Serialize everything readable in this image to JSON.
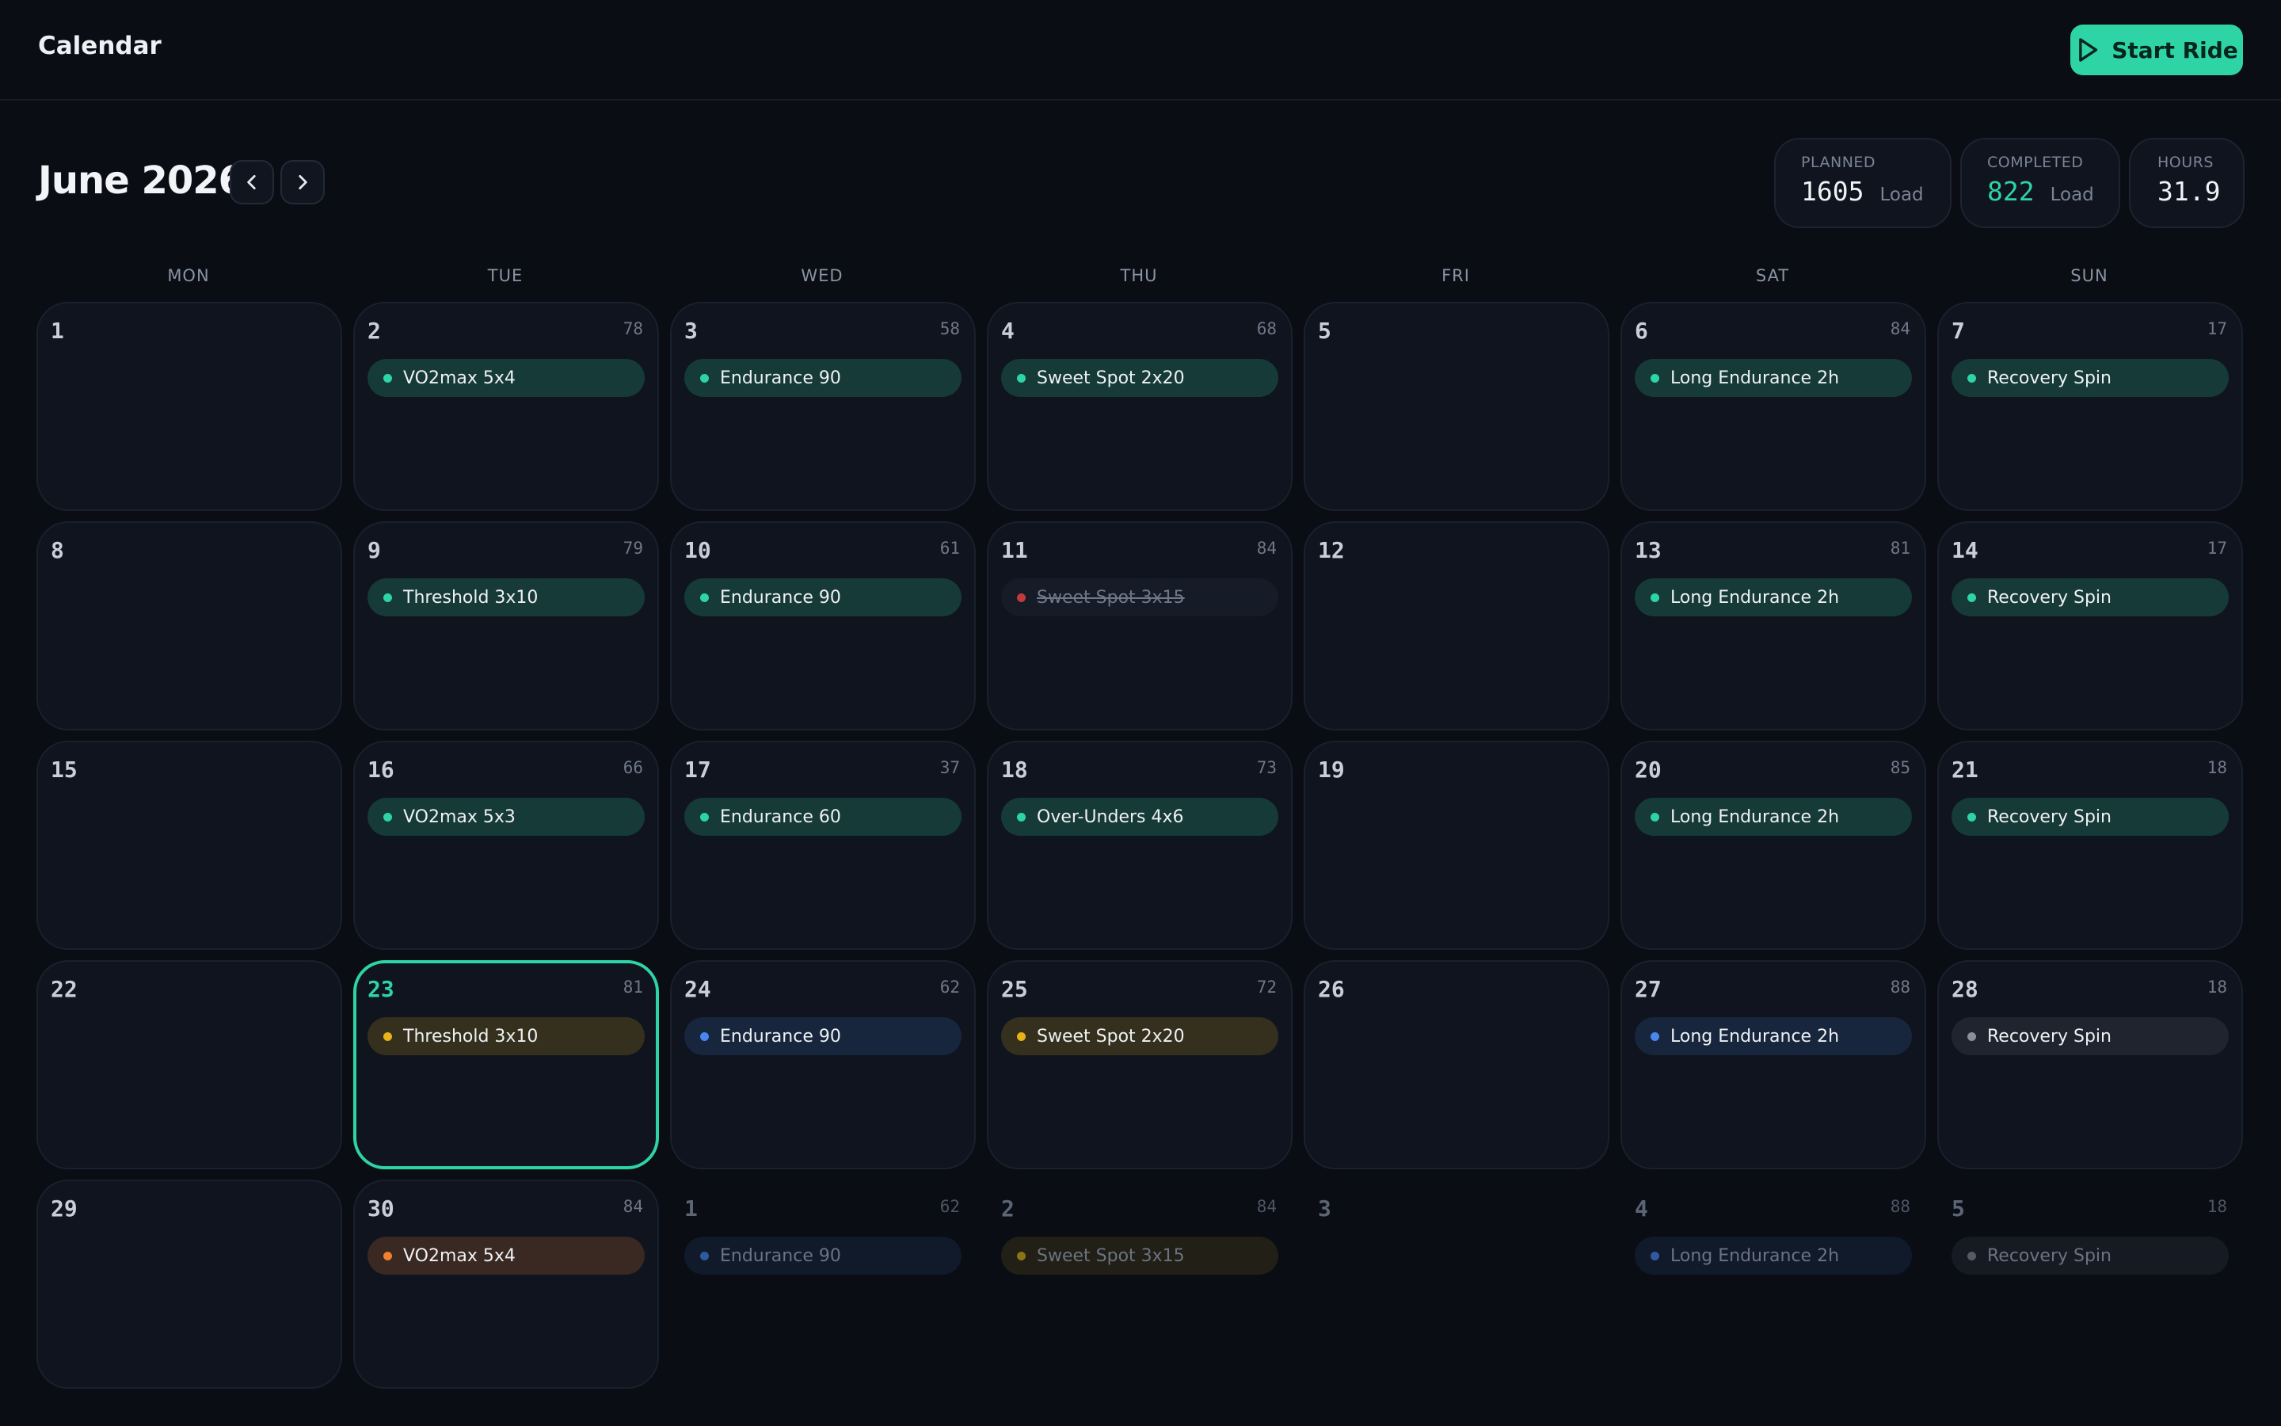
{
  "app": {
    "title": "Calendar"
  },
  "header": {
    "start_ride_label": "Start Ride"
  },
  "month": {
    "title": "June 2026"
  },
  "stats": {
    "planned": {
      "label": "PLANNED",
      "value": "1605",
      "unit": "Load"
    },
    "completed": {
      "label": "COMPLETED",
      "value": "822",
      "unit": "Load"
    },
    "hours": {
      "label": "HOURS",
      "value": "31.9"
    }
  },
  "weekdays": [
    "MON",
    "TUE",
    "WED",
    "THU",
    "FRI",
    "SAT",
    "SUN"
  ],
  "days": [
    {
      "day": "1"
    },
    {
      "day": "2",
      "load": "78",
      "workout": "VO2max 5x4",
      "status": "done"
    },
    {
      "day": "3",
      "load": "58",
      "workout": "Endurance 90",
      "status": "done"
    },
    {
      "day": "4",
      "load": "68",
      "workout": "Sweet Spot 2x20",
      "status": "done"
    },
    {
      "day": "5"
    },
    {
      "day": "6",
      "load": "84",
      "workout": "Long Endurance 2h",
      "status": "done"
    },
    {
      "day": "7",
      "load": "17",
      "workout": "Recovery Spin",
      "status": "done"
    },
    {
      "day": "8"
    },
    {
      "day": "9",
      "load": "79",
      "workout": "Threshold 3x10",
      "status": "done"
    },
    {
      "day": "10",
      "load": "61",
      "workout": "Endurance 90",
      "status": "done"
    },
    {
      "day": "11",
      "load": "84",
      "workout": "Sweet Spot 3x15",
      "status": "missed"
    },
    {
      "day": "12"
    },
    {
      "day": "13",
      "load": "81",
      "workout": "Long Endurance 2h",
      "status": "done"
    },
    {
      "day": "14",
      "load": "17",
      "workout": "Recovery Spin",
      "status": "done"
    },
    {
      "day": "15"
    },
    {
      "day": "16",
      "load": "66",
      "workout": "VO2max 5x3",
      "status": "done"
    },
    {
      "day": "17",
      "load": "37",
      "workout": "Endurance 60",
      "status": "done"
    },
    {
      "day": "18",
      "load": "73",
      "workout": "Over-Unders 4x6",
      "status": "done"
    },
    {
      "day": "19"
    },
    {
      "day": "20",
      "load": "85",
      "workout": "Long Endurance 2h",
      "status": "done"
    },
    {
      "day": "21",
      "load": "18",
      "workout": "Recovery Spin",
      "status": "done"
    },
    {
      "day": "22"
    },
    {
      "day": "23",
      "load": "81",
      "workout": "Threshold 3x10",
      "status": "yellow",
      "today": true
    },
    {
      "day": "24",
      "load": "62",
      "workout": "Endurance 90",
      "status": "blue"
    },
    {
      "day": "25",
      "load": "72",
      "workout": "Sweet Spot 2x20",
      "status": "yellow"
    },
    {
      "day": "26"
    },
    {
      "day": "27",
      "load": "88",
      "workout": "Long Endurance 2h",
      "status": "blue"
    },
    {
      "day": "28",
      "load": "18",
      "workout": "Recovery Spin",
      "status": "gray"
    },
    {
      "day": "29"
    },
    {
      "day": "30",
      "load": "84",
      "workout": "VO2max 5x4",
      "status": "orange"
    },
    {
      "day": "1",
      "load": "62",
      "workout": "Endurance 90",
      "status": "blue",
      "outside": true
    },
    {
      "day": "2",
      "load": "84",
      "workout": "Sweet Spot 3x15",
      "status": "yellow",
      "outside": true
    },
    {
      "day": "3",
      "outside": true
    },
    {
      "day": "4",
      "load": "88",
      "workout": "Long Endurance 2h",
      "status": "blue",
      "outside": true
    },
    {
      "day": "5",
      "load": "18",
      "workout": "Recovery Spin",
      "status": "gray",
      "outside": true
    }
  ]
}
